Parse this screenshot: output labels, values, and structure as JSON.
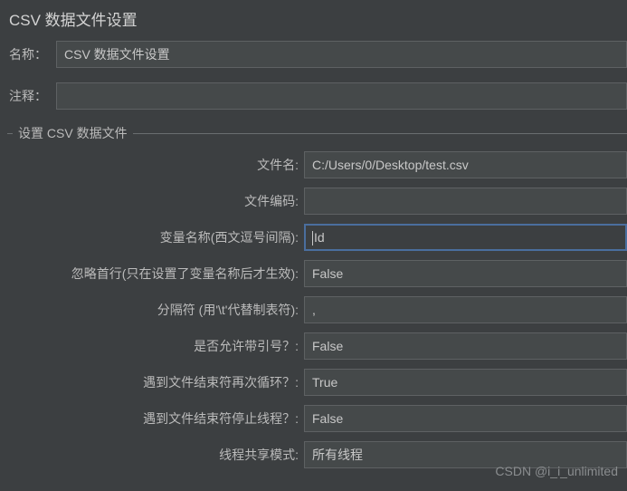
{
  "title": "CSV 数据文件设置",
  "top": {
    "name_label": "名称：",
    "name_value": "CSV 数据文件设置",
    "comment_label": "注释：",
    "comment_value": ""
  },
  "group": {
    "legend": "设置 CSV 数据文件",
    "rows": [
      {
        "label": "文件名:",
        "value": "C:/Users/0/Desktop/test.csv",
        "focused": false
      },
      {
        "label": "文件编码:",
        "value": "",
        "focused": false
      },
      {
        "label": "变量名称(西文逗号间隔):",
        "value": "Id",
        "focused": true
      },
      {
        "label": "忽略首行(只在设置了变量名称后才生效):",
        "value": "False",
        "focused": false
      },
      {
        "label": "分隔符 (用'\\t'代替制表符):",
        "value": ",",
        "focused": false
      },
      {
        "label": "是否允许带引号？:",
        "value": "False",
        "focused": false
      },
      {
        "label": "遇到文件结束符再次循环？:",
        "value": "True",
        "focused": false
      },
      {
        "label": "遇到文件结束符停止线程？:",
        "value": "False",
        "focused": false
      },
      {
        "label": "线程共享模式:",
        "value": "所有线程",
        "focused": false
      }
    ]
  },
  "watermark": "CSDN @i_i_unlimited"
}
